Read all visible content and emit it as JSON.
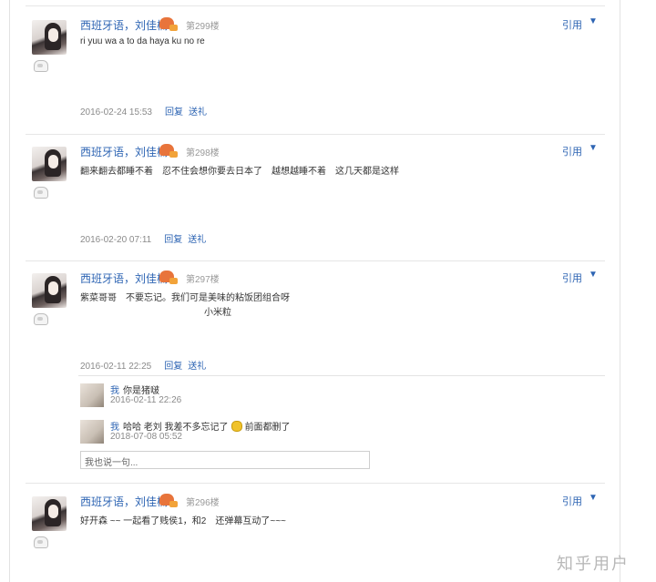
{
  "posts": [
    {
      "username": "西班牙语，刘佳楠",
      "floor": "第299楼",
      "quote": "引用",
      "content_line1": "ri yuu wa a to da haya ku no re",
      "content_line2": "",
      "timestamp": "2016-02-24 15:53",
      "reply": "回复",
      "gift": "送礼"
    },
    {
      "username": "西班牙语，刘佳楠",
      "floor": "第298楼",
      "quote": "引用",
      "content_line1": "翻来翻去都睡不着　忍不住会想你要去日本了　越想越睡不着　这几天都是这样",
      "content_line2": "",
      "timestamp": "2016-02-20 07:11",
      "reply": "回复",
      "gift": "送礼"
    },
    {
      "username": "西班牙语，刘佳楠",
      "floor": "第297楼",
      "quote": "引用",
      "content_line1": "紫菜哥哥　不要忘记。我们可是美味的粘饭团组合呀",
      "content_line2": "小米粒",
      "timestamp": "2016-02-11 22:25",
      "reply": "回复",
      "gift": "送礼",
      "replies": [
        {
          "user": "我",
          "text": "你是猪啵",
          "time": "2016-02-11 22:26"
        },
        {
          "user": "我",
          "text_before": "哈哈 老刘 我差不多忘记了",
          "text_after": "前面都删了",
          "time": "2018-07-08 05:52"
        }
      ],
      "reply_placeholder": "我也说一句..."
    },
    {
      "username": "西班牙语，刘佳楠",
      "floor": "第296楼",
      "quote": "引用",
      "content_line1": "好开森 ~~ 一起看了贱侯1，和2　还弹幕互动了~~~",
      "content_line2": "",
      "timestamp": "",
      "reply": "",
      "gift": ""
    }
  ],
  "watermark": "知乎用户",
  "colors": {
    "link": "#2d64b3",
    "meta": "#8a8a8a",
    "level_badge": "#e8743b"
  },
  "icons": [
    "avatar",
    "medal-icon",
    "level-badge-icon",
    "dropdown-triangle-icon",
    "smile-emoji-icon"
  ]
}
